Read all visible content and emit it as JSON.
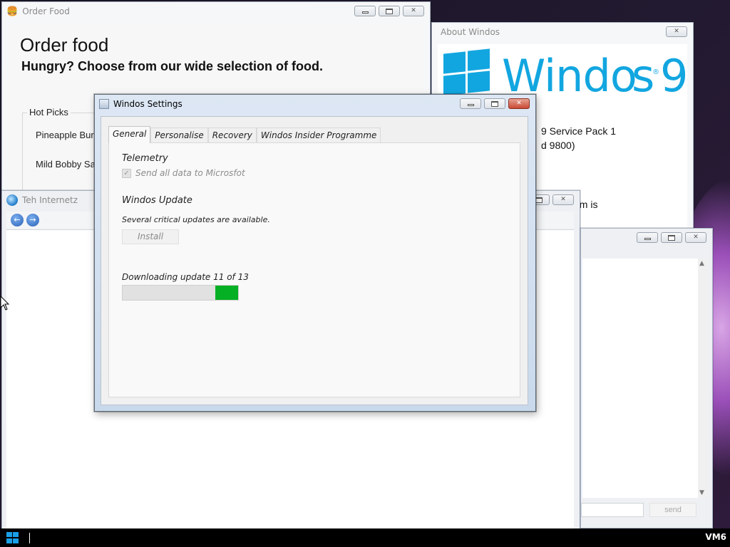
{
  "colors": {
    "windos_blue": "#12a6e0",
    "progress_green": "#06b025",
    "close_red": "#c84a34"
  },
  "icons": {
    "order_food": "burger-icon",
    "browser": "globe-icon",
    "back": "arrow-left-icon",
    "forward": "arrow-right-icon",
    "settings": "settings-window-icon",
    "start": "windows-logo-icon"
  },
  "order_food": {
    "title": "Order Food",
    "heading": "Order food",
    "subheading": "Hungry? Choose from our wide selection of food.",
    "group_label": "Hot Picks",
    "items": [
      "Pineapple Burg",
      "Mild Bobby Sau"
    ]
  },
  "about": {
    "title": "About Windos",
    "logo_text": "Windo",
    "logo_text_tail": "s",
    "logo_version": "9",
    "logo_reg": "®",
    "lines": [
      "9 Service Pack 1",
      "d 9800)",
      "em is"
    ]
  },
  "browser": {
    "title": "Teh Internetz",
    "back_glyph": "←",
    "forward_glyph": "→"
  },
  "chat": {
    "input_value": "",
    "send_label": "send",
    "scroll_up": "▲",
    "scroll_down": "▼"
  },
  "settings": {
    "title": "Windos Settings",
    "tabs": [
      "General",
      "Personalise",
      "Recovery",
      "Windos Insider Programme"
    ],
    "active_tab": "General",
    "telemetry": {
      "heading": "Telemetry",
      "checkbox_label": "Send all data to Microsfot",
      "checked": true,
      "check_glyph": "✓"
    },
    "update": {
      "heading": "Windos Update",
      "status": "Several critical updates are available.",
      "install_label": "Install",
      "download_label": "Downloading update 11 of 13",
      "progress_fraction": 0.2
    }
  },
  "window_controls": {
    "close_glyph": "✕"
  },
  "taskbar": {
    "vm_label": "VM6"
  }
}
